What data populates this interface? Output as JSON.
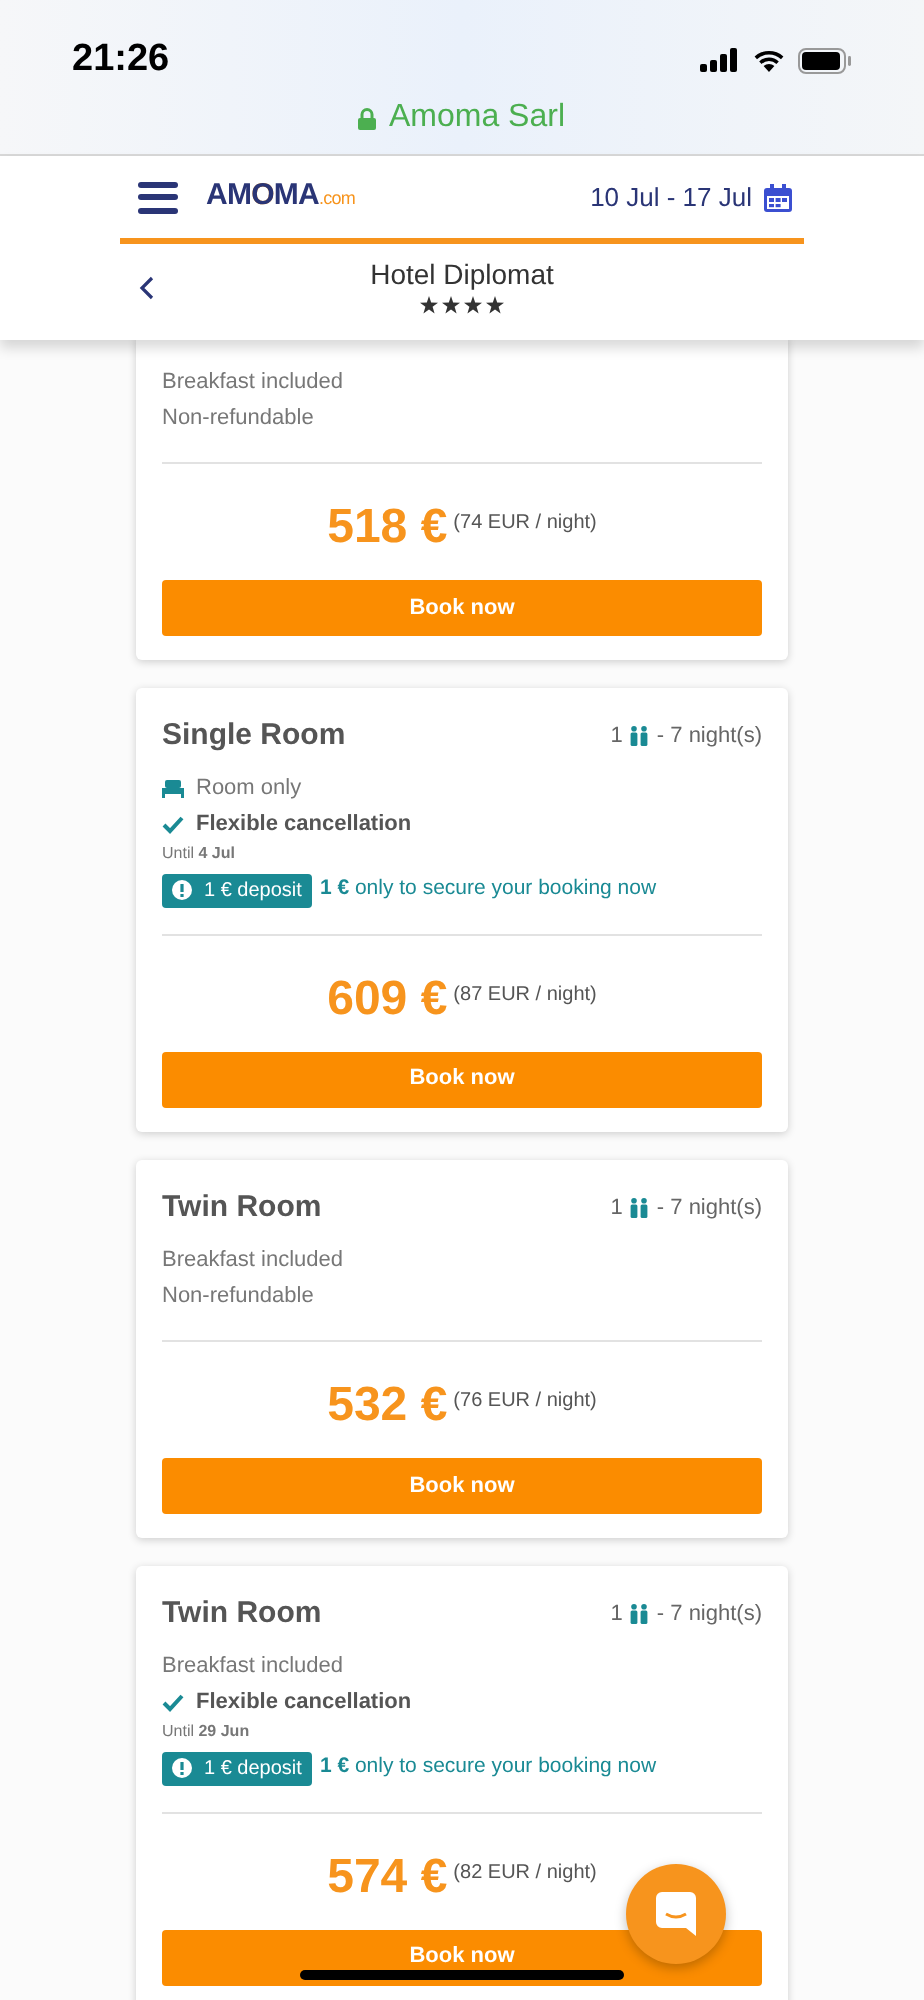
{
  "status_bar": {
    "time": "21:26"
  },
  "url_bar": {
    "site": "Amoma Sarl",
    "secure": true
  },
  "header": {
    "logo_main": "AM",
    "logo_o": "O",
    "logo_rest": "MA",
    "logo_suffix": ".com",
    "dates": "10 Jul - 17 Jul"
  },
  "hotel": {
    "name": "Hotel Diplomat",
    "stars": 4
  },
  "offers": [
    {
      "features": [
        {
          "kind": "plain",
          "text": "Breakfast included"
        },
        {
          "kind": "plain",
          "text": "Non-refundable"
        }
      ],
      "price": "518 €",
      "per_night": "(74 EUR / night)",
      "button": "Book now"
    },
    {
      "title": "Single Room",
      "guests": "1",
      "nights": "- 7 night(s)",
      "features": [
        {
          "kind": "room",
          "text": "Room only"
        },
        {
          "kind": "check",
          "text": "Flexible cancellation",
          "until": "Until **4 Jul**"
        }
      ],
      "deposit": {
        "badge": "1 € deposit",
        "text": "**1 €** only to secure your booking now"
      },
      "price": "609 €",
      "per_night": "(87 EUR / night)",
      "button": "Book now"
    },
    {
      "title": "Twin Room",
      "guests": "1",
      "nights": "- 7 night(s)",
      "features": [
        {
          "kind": "plain",
          "text": "Breakfast included"
        },
        {
          "kind": "plain",
          "text": "Non-refundable"
        }
      ],
      "price": "532 €",
      "per_night": "(76 EUR / night)",
      "button": "Book now"
    },
    {
      "title": "Twin Room",
      "guests": "1",
      "nights": "- 7 night(s)",
      "features": [
        {
          "kind": "plain",
          "text": "Breakfast included"
        },
        {
          "kind": "check",
          "text": "Flexible cancellation",
          "until": "Until **29 Jun**"
        }
      ],
      "deposit": {
        "badge": "1 € deposit",
        "text": "**1 €** only to secure your booking now"
      },
      "price": "574 €",
      "per_night": "(82 EUR / night)",
      "button": "Book now"
    }
  ]
}
